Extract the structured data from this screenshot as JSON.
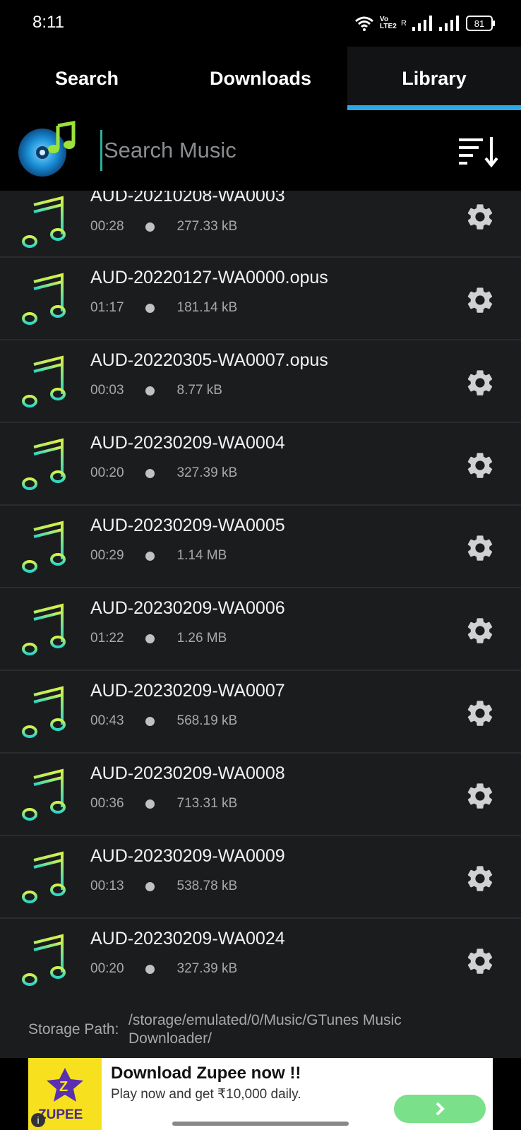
{
  "status_bar": {
    "time": "8:11",
    "battery": "81",
    "volte_label": "Vo LTE2",
    "roaming_label": "R"
  },
  "tabs": [
    {
      "label": "Search",
      "active": false
    },
    {
      "label": "Downloads",
      "active": false
    },
    {
      "label": "Library",
      "active": true
    }
  ],
  "search": {
    "placeholder": "Search Music",
    "value": ""
  },
  "tracks": [
    {
      "title": "AUD-20210208-WA0003",
      "duration": "00:28",
      "size": "277.33 kB"
    },
    {
      "title": "AUD-20220127-WA0000.opus",
      "duration": "01:17",
      "size": "181.14 kB"
    },
    {
      "title": "AUD-20220305-WA0007.opus",
      "duration": "00:03",
      "size": "8.77 kB"
    },
    {
      "title": "AUD-20230209-WA0004",
      "duration": "00:20",
      "size": "327.39 kB"
    },
    {
      "title": "AUD-20230209-WA0005",
      "duration": "00:29",
      "size": "1.14 MB"
    },
    {
      "title": "AUD-20230209-WA0006",
      "duration": "01:22",
      "size": "1.26 MB"
    },
    {
      "title": "AUD-20230209-WA0007",
      "duration": "00:43",
      "size": "568.19 kB"
    },
    {
      "title": "AUD-20230209-WA0008",
      "duration": "00:36",
      "size": "713.31 kB"
    },
    {
      "title": "AUD-20230209-WA0009",
      "duration": "00:13",
      "size": "538.78 kB"
    },
    {
      "title": "AUD-20230209-WA0024",
      "duration": "00:20",
      "size": "327.39 kB"
    }
  ],
  "storage": {
    "label": "Storage Path:",
    "path": "/storage/emulated/0/Music/GTunes Music Downloader/"
  },
  "ad": {
    "logo_text": "ZUPEE",
    "title": "Download Zupee now !!",
    "subtitle": "Play now and get ₹10,000 daily."
  },
  "colors": {
    "accent": "#2aa9e8",
    "list_bg": "#1b1c1e",
    "ad_cta": "#7be08a"
  }
}
